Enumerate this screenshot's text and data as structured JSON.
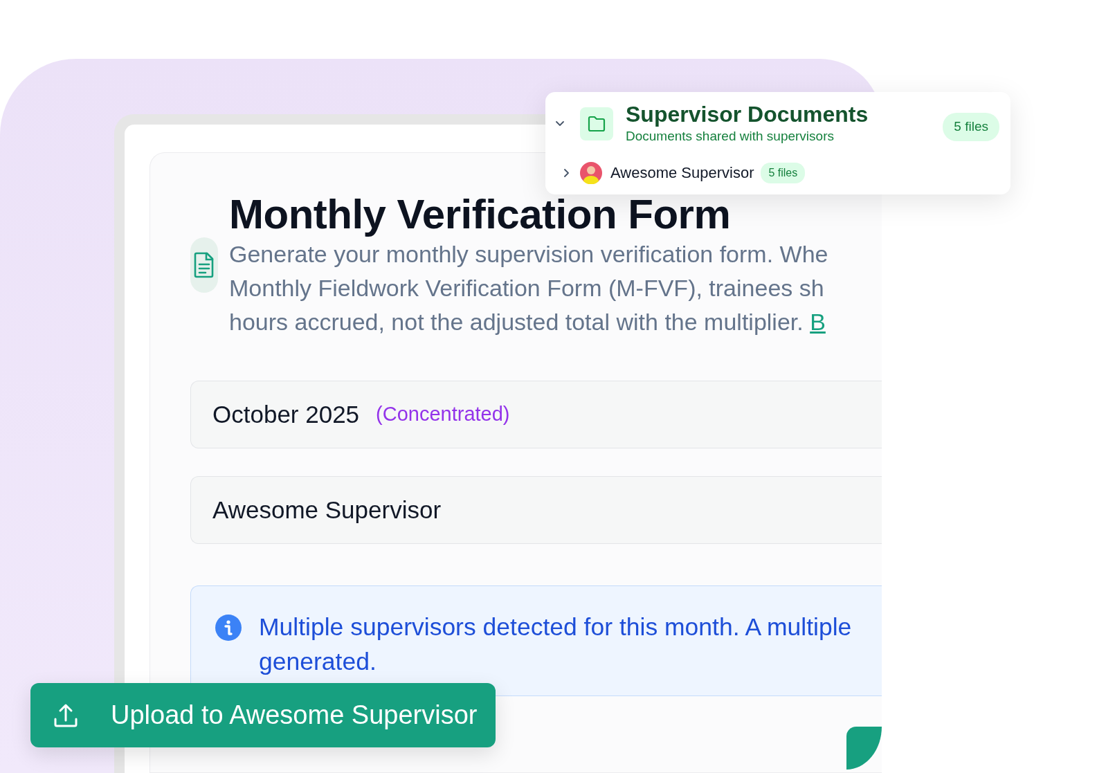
{
  "card": {
    "expanded": true,
    "title": "Supervisor Documents",
    "subtitle": "Documents shared with supervisors",
    "count": "5 files",
    "children": [
      {
        "name": "Awesome Supervisor",
        "count": "5 files",
        "expanded": false
      }
    ]
  },
  "form": {
    "title": "Monthly Verification Form",
    "description_lines": [
      "Generate your monthly supervision verification form. Whe",
      "Monthly Fieldwork Verification Form (M-FVF), trainees sh",
      "hours accrued, not the adjusted total with the multiplier."
    ],
    "description_link": "B",
    "fields": [
      {
        "value": "October 2025",
        "note": "(Concentrated)"
      },
      {
        "value": "Awesome Supervisor"
      }
    ],
    "alert": {
      "lines": [
        "Multiple supervisors detected for this month. A multiple",
        "generated."
      ]
    }
  },
  "upload_button": {
    "label": "Upload to Awesome Supervisor"
  }
}
